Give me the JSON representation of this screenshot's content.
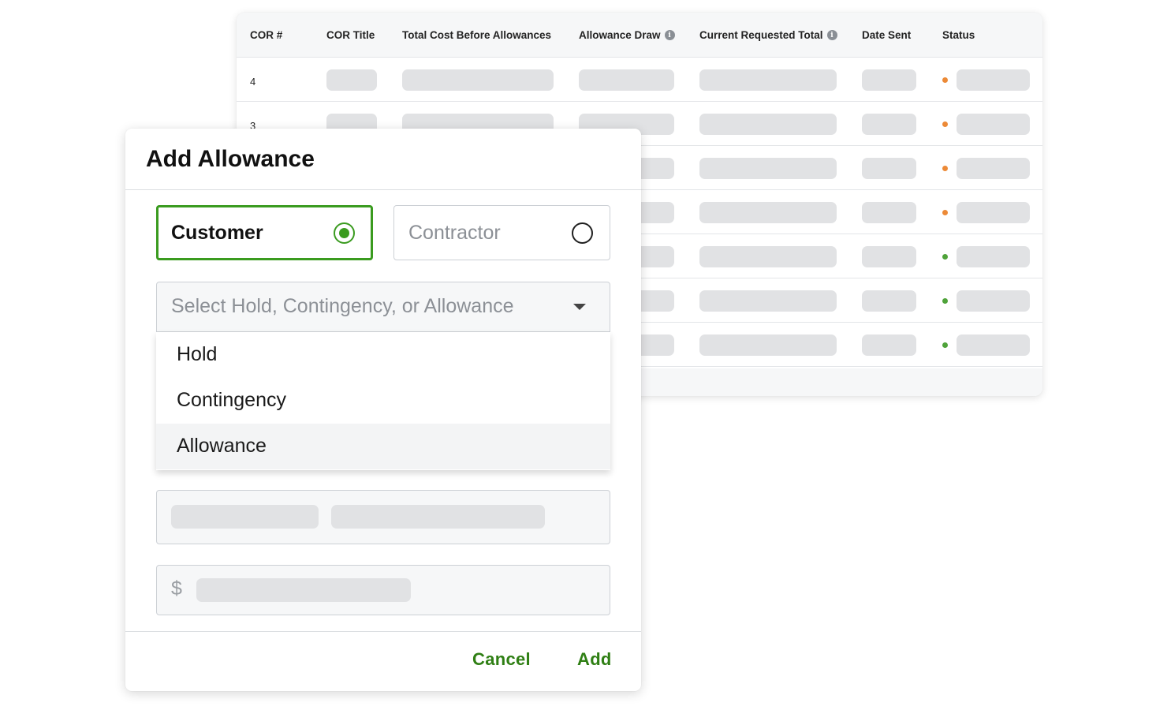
{
  "table": {
    "headers": {
      "cor_num": "COR #",
      "cor_title": "COR Title",
      "total_cost": "Total Cost Before Allowances",
      "allowance_draw": "Allowance Draw",
      "current_requested": "Current Requested Total",
      "date_sent": "Date Sent",
      "status": "Status"
    },
    "info_icon": "info-icon",
    "rows": [
      {
        "num": "4",
        "status_color": "#ec8a37"
      },
      {
        "num": "3",
        "status_color": "#ec8a37"
      },
      {
        "num": "",
        "status_color": "#ec8a37"
      },
      {
        "num": "",
        "status_color": "#ec8a37"
      },
      {
        "num": "",
        "status_color": "#4fa33a"
      },
      {
        "num": "",
        "status_color": "#4fa33a"
      },
      {
        "num": "",
        "status_color": "#4fa33a"
      }
    ]
  },
  "modal": {
    "title": "Add Allowance",
    "radio_options": [
      {
        "label": "Customer",
        "selected": true
      },
      {
        "label": "Contractor",
        "selected": false
      }
    ],
    "type_select": {
      "placeholder": "Select Hold, Contingency, or Allowance",
      "options": [
        "Hold",
        "Contingency",
        "Allowance"
      ],
      "highlighted": "Allowance"
    },
    "amount_prefix": "$",
    "buttons": {
      "cancel": "Cancel",
      "add": "Add"
    }
  },
  "colors": {
    "accent_green": "#3a9b1f",
    "button_green": "#2f7f14",
    "status_pending": "#ec8a37",
    "status_approved": "#4fa33a",
    "skeleton": "#e1e2e4"
  }
}
